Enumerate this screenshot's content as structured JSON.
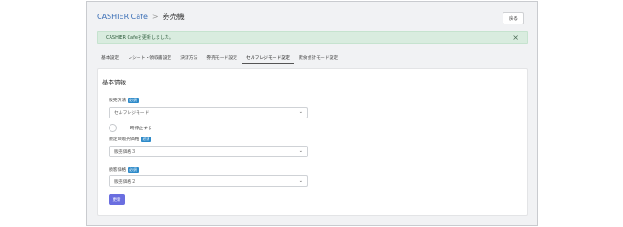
{
  "breadcrumb": {
    "parent": "CASHIER Cafe",
    "separator": ">",
    "current": "券売機"
  },
  "back_button": "戻る",
  "alert": {
    "message": "CASHIER Cafeを更新しました。",
    "close": "×"
  },
  "tabs": [
    {
      "label": "基本設定",
      "active": false
    },
    {
      "label": "レシート・領収書設定",
      "active": false
    },
    {
      "label": "決済方法",
      "active": false
    },
    {
      "label": "券売モード設定",
      "active": false
    },
    {
      "label": "セルフレジモード設定",
      "active": true
    },
    {
      "label": "飲食会計モード設定",
      "active": false
    }
  ],
  "card": {
    "title": "基本情報",
    "required_badge": "必須",
    "sales_method": {
      "label": "販売方法",
      "value": "セルフレジモード"
    },
    "pause_toggle": {
      "label": "一時停止する",
      "checked": false
    },
    "default_price": {
      "label": "規定の販売価格",
      "value": "販売価格３"
    },
    "customer_price": {
      "label": "顧客価格",
      "value": "販売価格２"
    },
    "submit": "更新"
  }
}
